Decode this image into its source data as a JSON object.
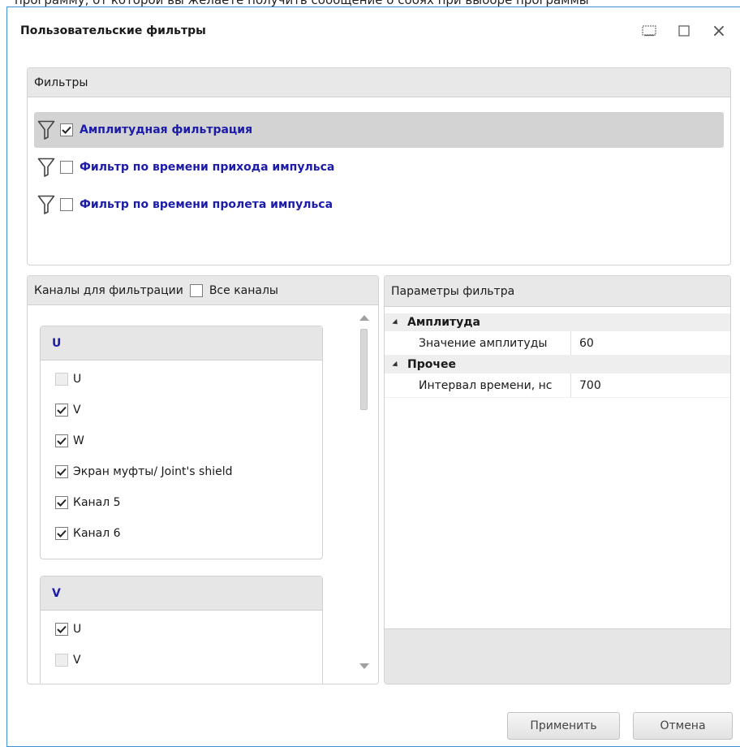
{
  "background_text": "программу, от которой вы желаете получить сообщение о сбоях при выборе программы",
  "dialog": {
    "title": "Пользовательские фильтры",
    "window_buttons": [
      "restore-down-icon",
      "maximize-icon",
      "close-icon"
    ],
    "close_glyph": "×"
  },
  "filters": {
    "header": "Фильтры",
    "items": [
      {
        "label": "Амплитудная фильтрация",
        "checked": true,
        "selected": true
      },
      {
        "label": "Фильтр по времени прихода импульса",
        "checked": false,
        "selected": false
      },
      {
        "label": "Фильтр по времени пролета импульса",
        "checked": false,
        "selected": false
      }
    ]
  },
  "channels": {
    "header": "Каналы для фильтрации",
    "all_label": "Все каналы",
    "all_checked": false,
    "groups": [
      {
        "name": "U",
        "items": [
          {
            "label": "U",
            "checked": false,
            "disabled": true
          },
          {
            "label": "V",
            "checked": true,
            "disabled": false
          },
          {
            "label": "W",
            "checked": true,
            "disabled": false
          },
          {
            "label": "Экран муфты/ Joint's shield",
            "checked": true,
            "disabled": false
          },
          {
            "label": "Канал 5",
            "checked": true,
            "disabled": false
          },
          {
            "label": "Канал 6",
            "checked": true,
            "disabled": false
          }
        ]
      },
      {
        "name": "V",
        "items": [
          {
            "label": "U",
            "checked": true,
            "disabled": false
          },
          {
            "label": "V",
            "checked": false,
            "disabled": true
          }
        ]
      }
    ]
  },
  "params": {
    "header": "Параметры фильтра",
    "categories": [
      {
        "name": "Амплитуда",
        "props": [
          {
            "name": "Значение амплитуды",
            "value": "60"
          }
        ]
      },
      {
        "name": "Прочее",
        "props": [
          {
            "name": "Интервал времени, нс",
            "value": "700"
          }
        ]
      }
    ]
  },
  "buttons": {
    "apply": "Применить",
    "cancel": "Отмена"
  },
  "colors": {
    "accent_border": "#3f8fd6",
    "filter_label": "#1c1ca8",
    "selected_row": "#d3d3d3"
  }
}
